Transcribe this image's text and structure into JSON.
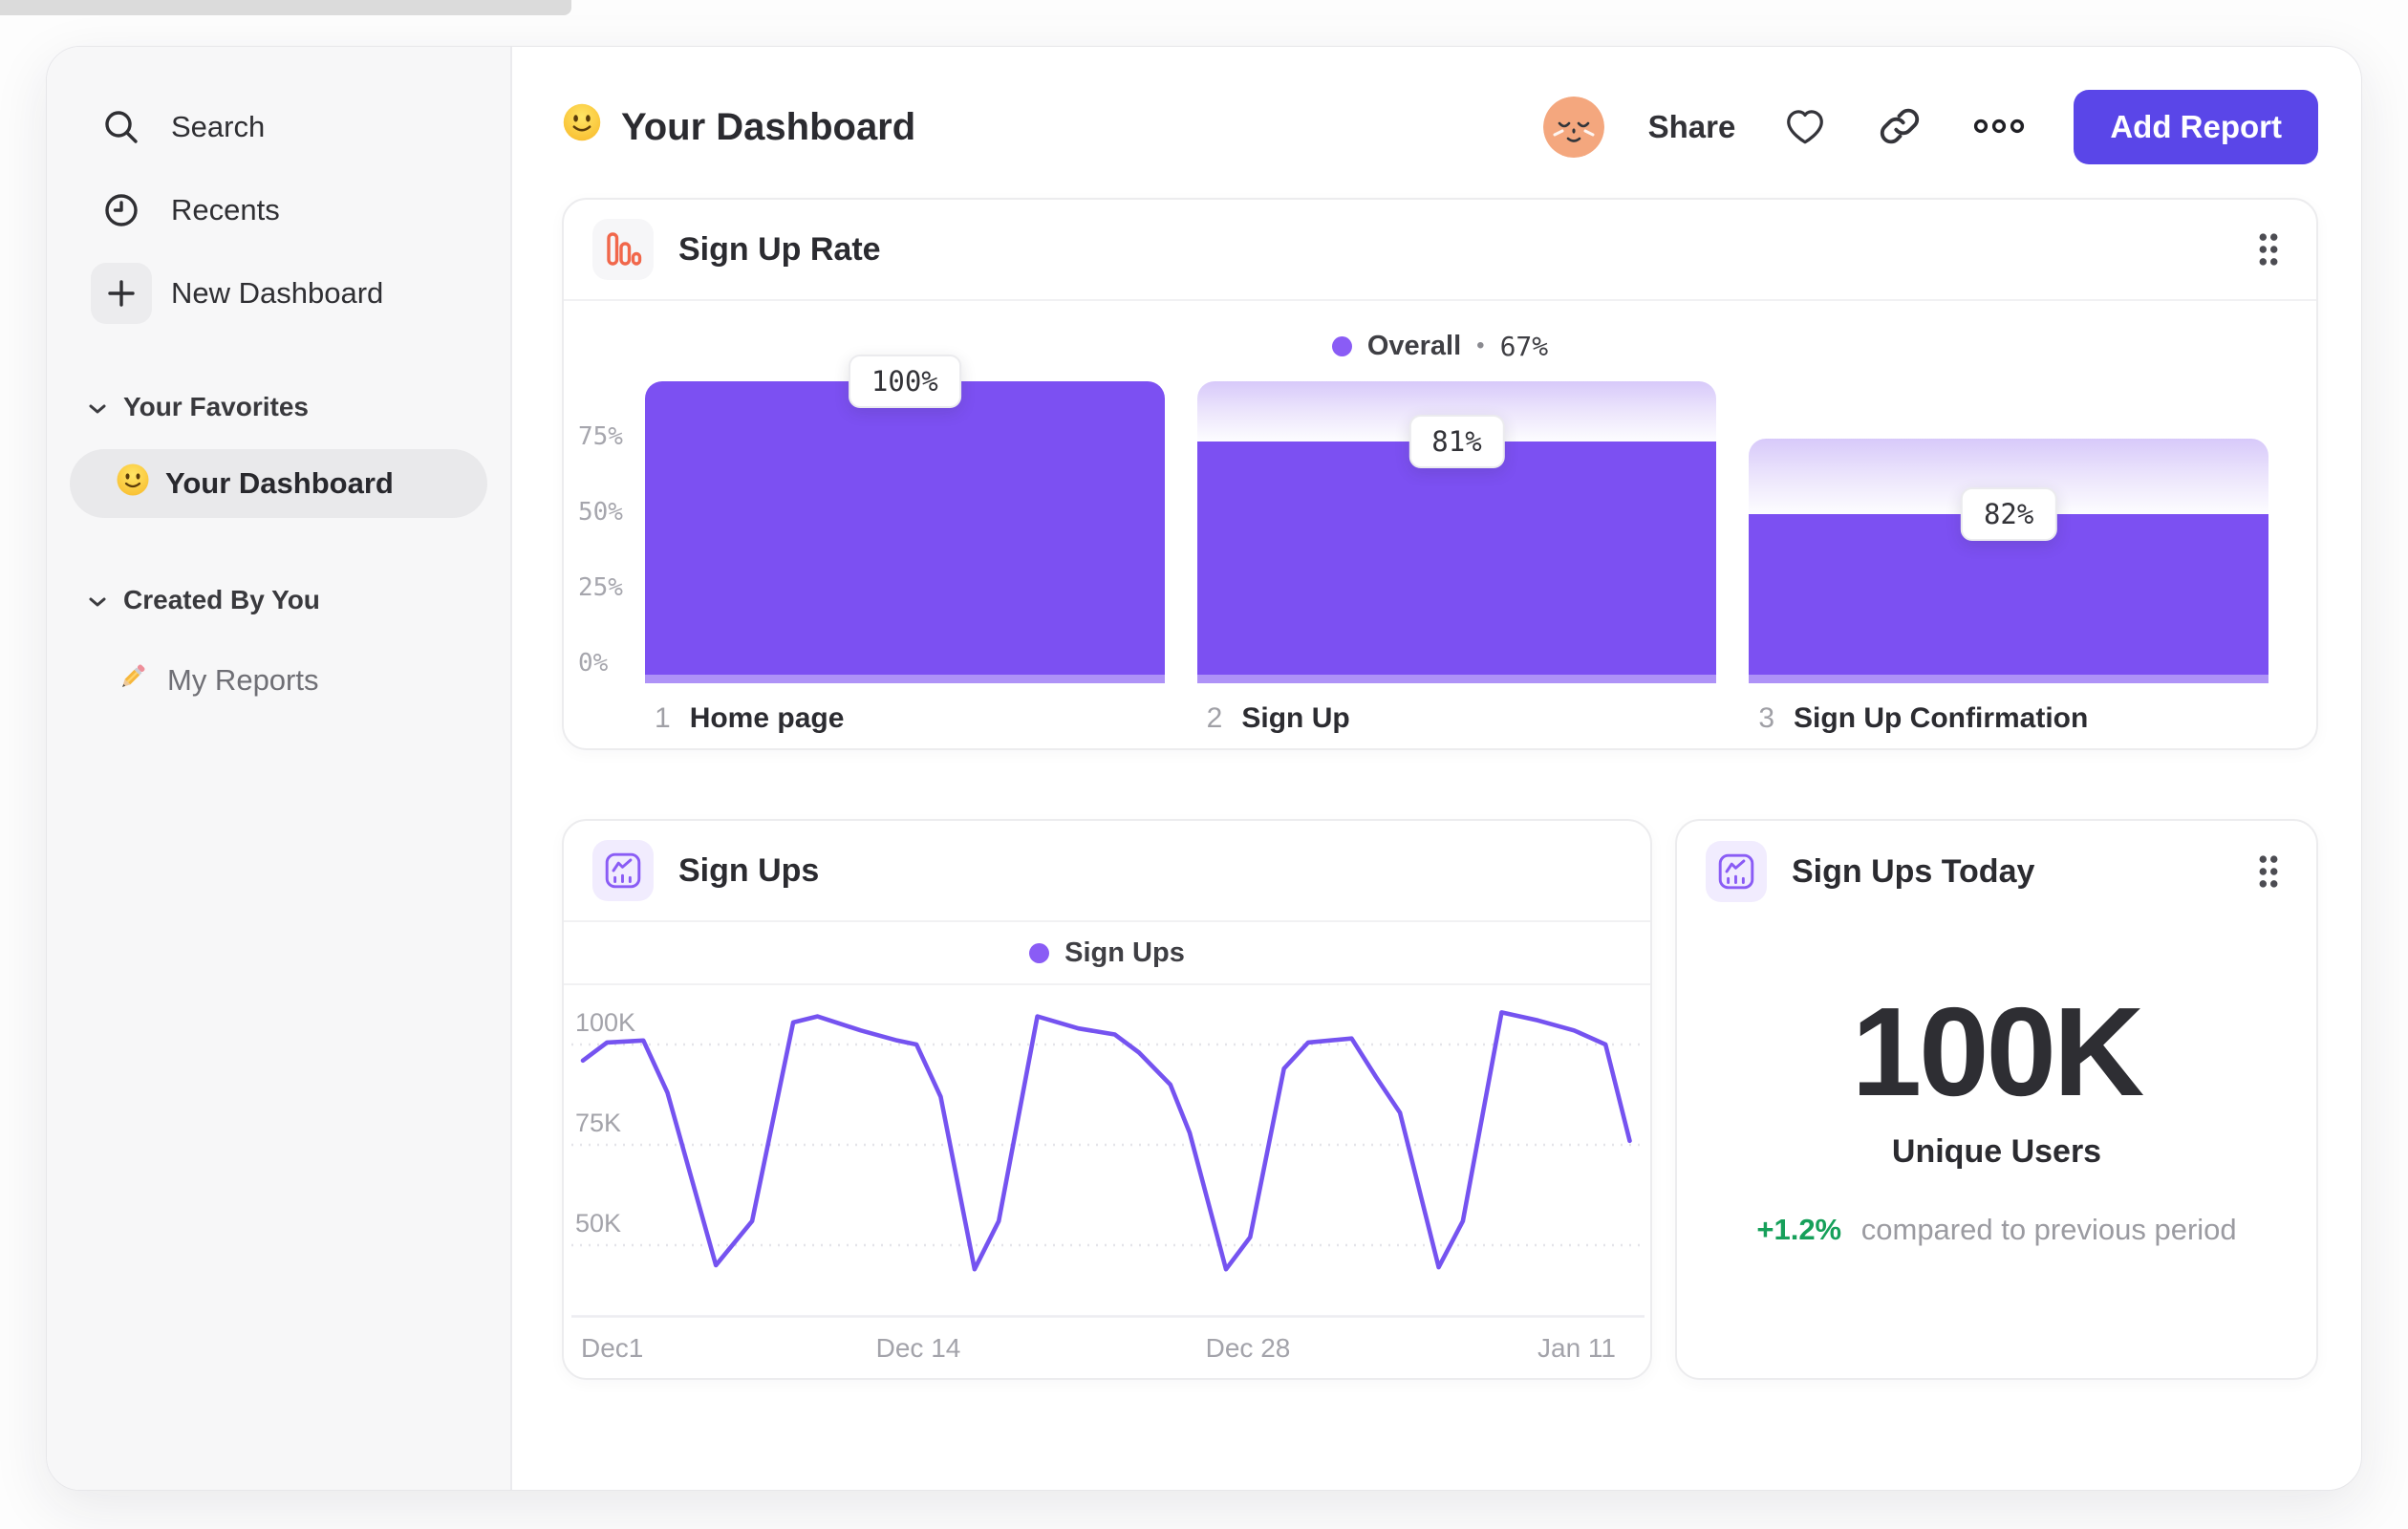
{
  "sidebar": {
    "items": [
      {
        "label": "Search",
        "icon": "search-icon"
      },
      {
        "label": "Recents",
        "icon": "clock-icon"
      },
      {
        "label": "New Dashboard",
        "icon": "plus-icon"
      }
    ],
    "sections": [
      {
        "label": "Your Favorites",
        "items": [
          {
            "label": "Your Dashboard",
            "icon": "smiley-emoji",
            "active": true
          }
        ]
      },
      {
        "label": "Created By You",
        "items": [
          {
            "label": "My Reports",
            "icon": "pencil-emoji",
            "active": false
          }
        ]
      }
    ]
  },
  "header": {
    "title": "Your Dashboard",
    "share_label": "Share",
    "add_report_label": "Add Report",
    "accent_color": "#5a46e8"
  },
  "cards": {
    "signups_today": {
      "title": "Sign Ups Today",
      "value": "100K",
      "unit": "Unique Users",
      "delta": "+1.2%",
      "delta_color": "#16a05a",
      "delta_note": "compared to previous period"
    }
  },
  "chart_data": [
    {
      "type": "bar",
      "variant": "funnel",
      "title": "Sign Up Rate",
      "legend": {
        "name": "Overall",
        "separator": "•",
        "value": "67%",
        "dot_color": "#8a5cf5"
      },
      "bar_color": "#7c50f2",
      "ylim": [
        0,
        100
      ],
      "y_ticks": [
        "75%",
        "50%",
        "25%",
        "0%"
      ],
      "y_tick_values": [
        75,
        50,
        25,
        0
      ],
      "steps": [
        {
          "index": "1",
          "label": "Home page",
          "conversion_label": "100%",
          "conversion_pct": 100,
          "bar_top_pct": 100,
          "solid_pct": 100
        },
        {
          "index": "2",
          "label": "Sign Up",
          "conversion_label": "81%",
          "conversion_pct": 81,
          "bar_top_pct": 100,
          "solid_pct": 80
        },
        {
          "index": "3",
          "label": "Sign Up Confirmation",
          "conversion_label": "82%",
          "conversion_pct": 82,
          "bar_top_pct": 81,
          "solid_pct": 56
        }
      ]
    },
    {
      "type": "line",
      "title": "Sign Ups",
      "legend": {
        "name": "Sign Ups",
        "dot_color": "#8a5cf5"
      },
      "line_color": "#7553f0",
      "grid": "dashed-horizontal",
      "y_ticks": [
        "100K",
        "75K",
        "50K"
      ],
      "y_tick_values_k": [
        100,
        75,
        50
      ],
      "x_ticks": [
        "Dec1",
        "Dec 14",
        "Dec 28",
        "Jan 11"
      ],
      "points_day_value_k": [
        [
          0,
          96
        ],
        [
          1,
          100.5
        ],
        [
          2.5,
          101
        ],
        [
          3.5,
          88
        ],
        [
          5.5,
          45
        ],
        [
          7,
          56
        ],
        [
          8.7,
          105.5
        ],
        [
          9.7,
          107
        ],
        [
          11.5,
          103.5
        ],
        [
          13,
          101
        ],
        [
          13.8,
          100
        ],
        [
          14.8,
          87
        ],
        [
          16.2,
          44
        ],
        [
          17.2,
          56
        ],
        [
          18.8,
          107
        ],
        [
          20.5,
          104
        ],
        [
          22,
          102.5
        ],
        [
          23,
          98
        ],
        [
          24.3,
          90
        ],
        [
          25.1,
          78
        ],
        [
          26.6,
          44
        ],
        [
          27.6,
          52
        ],
        [
          29,
          94
        ],
        [
          30,
          100.5
        ],
        [
          31.8,
          101.5
        ],
        [
          32.8,
          92
        ],
        [
          33.8,
          83
        ],
        [
          35.4,
          44.5
        ],
        [
          36.4,
          56
        ],
        [
          38,
          108
        ],
        [
          39.5,
          106
        ],
        [
          41,
          103.5
        ],
        [
          42.3,
          100
        ],
        [
          43.3,
          76
        ]
      ]
    }
  ]
}
